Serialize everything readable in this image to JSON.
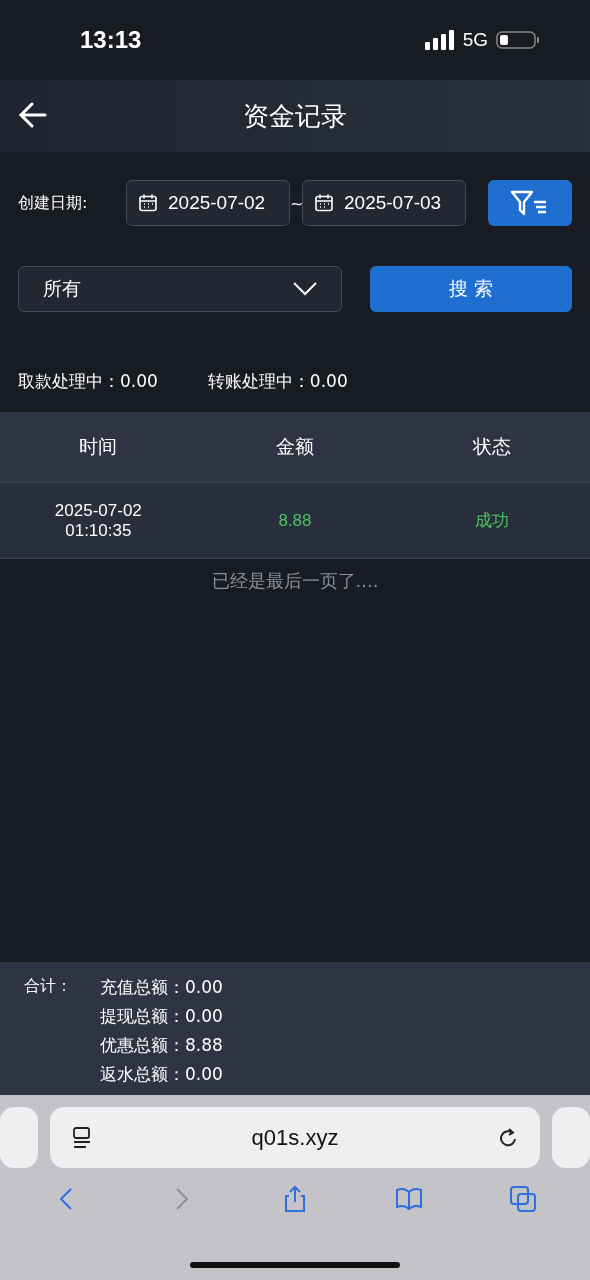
{
  "status_bar": {
    "time": "13:13",
    "network": "5G"
  },
  "header": {
    "title": "资金记录"
  },
  "filters": {
    "date_label": "创建日期:",
    "date_from": "2025-07-02",
    "separator": "~",
    "date_to": "2025-07-03",
    "type_select": "所有",
    "search_button": "搜 索"
  },
  "pending": [
    "取款处理中：0.00",
    "转账处理中：0.00"
  ],
  "table": {
    "columns": [
      "时间",
      "金额",
      "状态"
    ],
    "rows": [
      {
        "date": "2025-07-02",
        "time": "01:10:35",
        "amount": "8.88",
        "status": "成功"
      }
    ]
  },
  "end_note": "已经是最后一页了....",
  "totals": {
    "label": "合计：",
    "items": [
      "充值总额：0.00",
      "提现总额：0.00",
      "优惠总额：8.88",
      "返水总额：0.00"
    ]
  },
  "browser": {
    "url": "q01s.xyz",
    "toolbar": [
      {
        "kind": "back",
        "disabled": false
      },
      {
        "kind": "forward",
        "disabled": true
      },
      {
        "kind": "share",
        "disabled": false
      },
      {
        "kind": "bookmarks",
        "disabled": false
      },
      {
        "kind": "tabs",
        "disabled": false
      }
    ]
  }
}
